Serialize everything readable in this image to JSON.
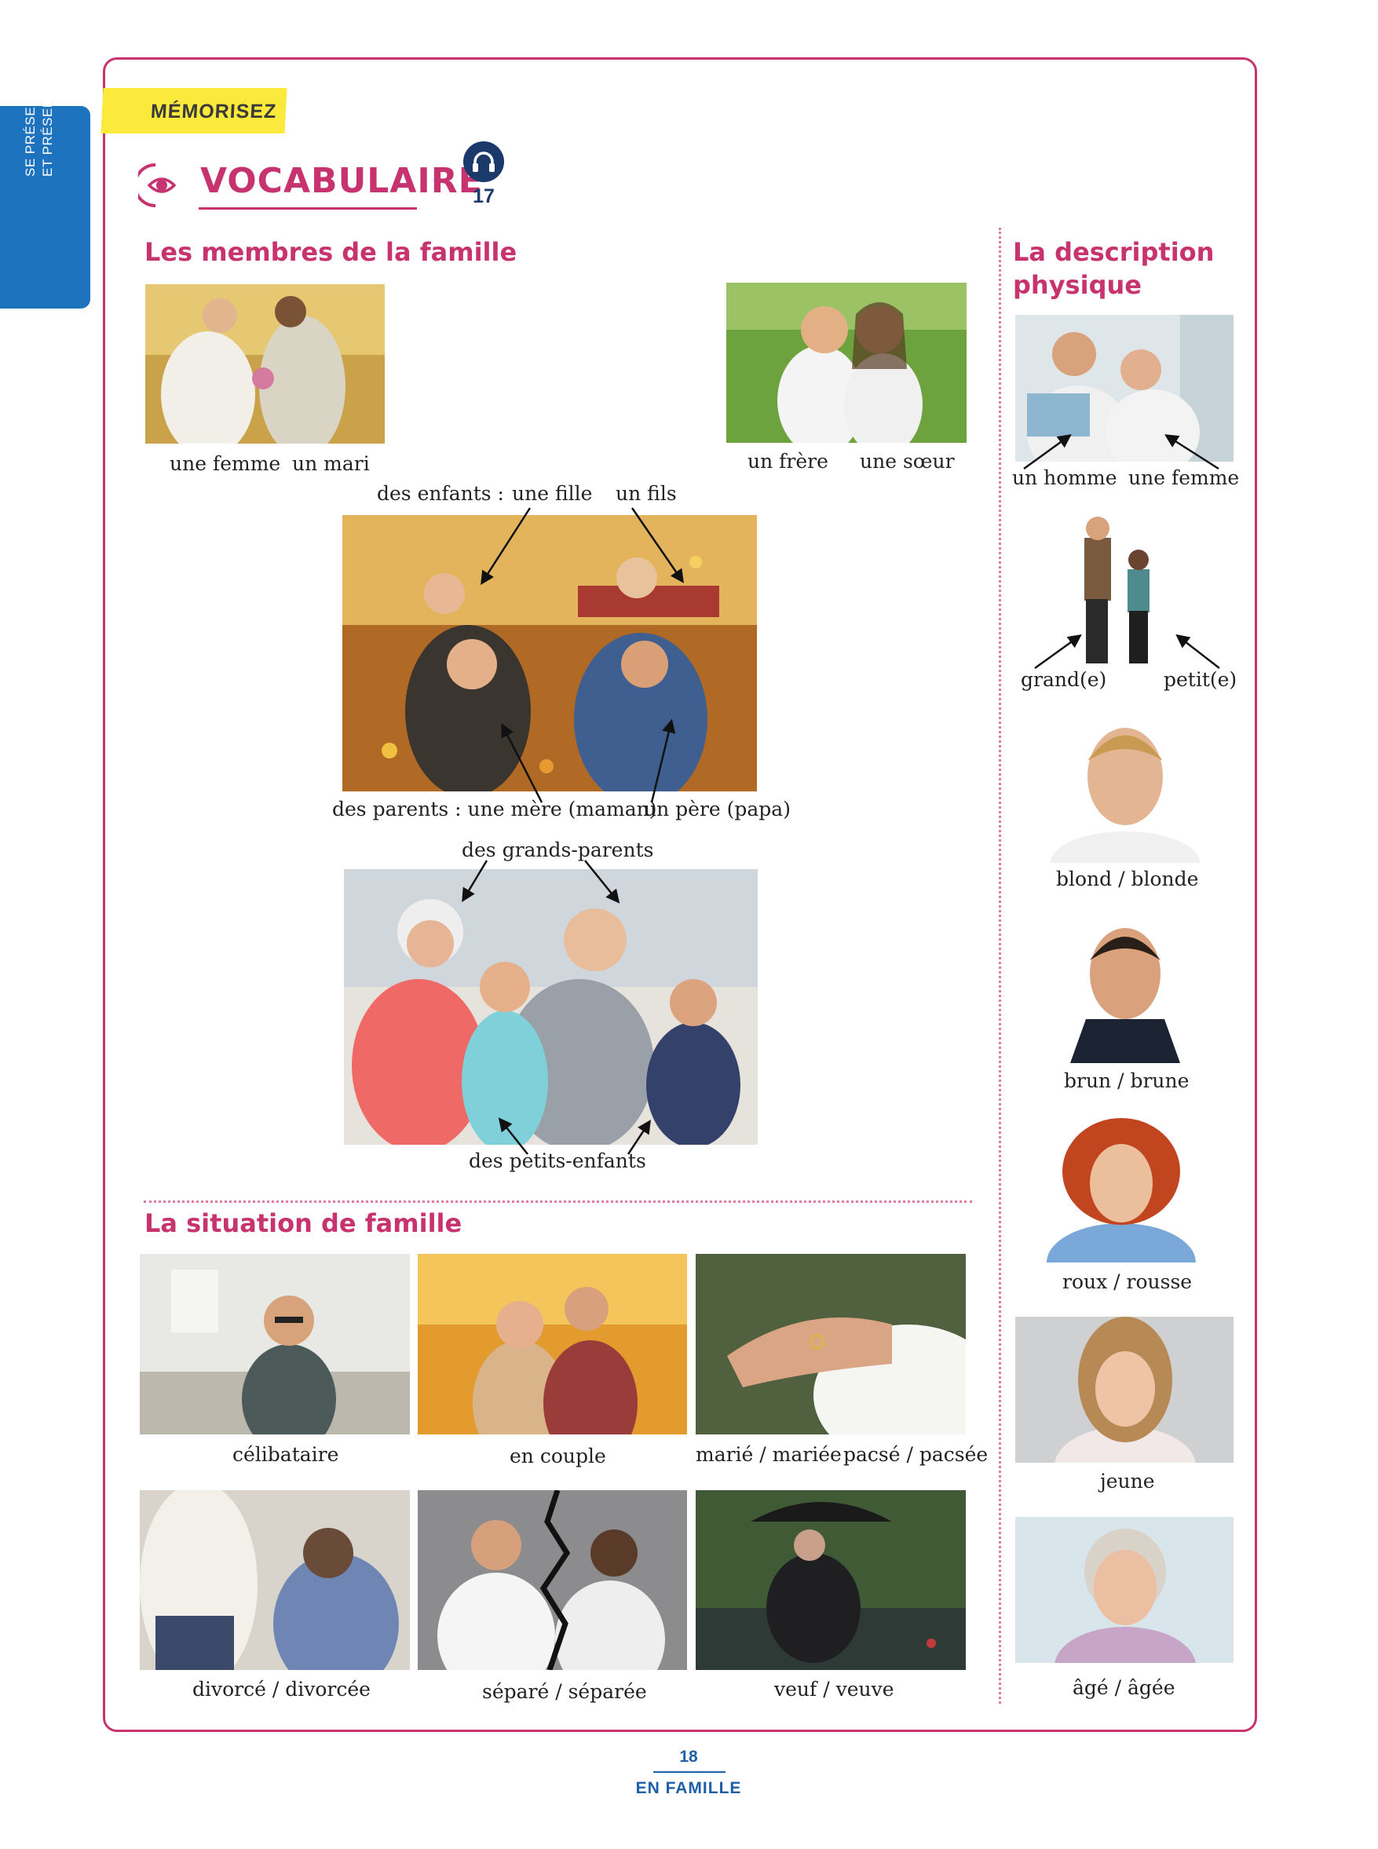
{
  "sidebar": {
    "tab_line1": "SE PRÉSENTER",
    "tab_line2": "ET PRÉSENTER"
  },
  "header": {
    "badge": "MÉMORISEZ",
    "title": "VOCABULAIRE",
    "audio_track": "17",
    "icons": [
      "eye-icon",
      "headphones-icon"
    ]
  },
  "colors": {
    "accent": "#c7336f",
    "badge": "#fbe93b",
    "tab": "#1e73be",
    "footer": "#1e5fa8"
  },
  "famille": {
    "heading": "Les membres de la famille",
    "couple_wife": "une femme",
    "couple_husband": "un mari",
    "brother": "un frère",
    "sister": "une sœur",
    "children_label": "des enfants :",
    "daughter": "une fille",
    "son": "un fils",
    "parents_line1": "des parents : une mère (maman)",
    "parents_line2": "un père (papa)",
    "grandparents": "des grands-parents",
    "grandchildren": "des petits-enfants"
  },
  "situation": {
    "heading": "La situation de famille",
    "items": [
      "célibataire",
      "en couple",
      "marié / mariée",
      "pacsé / pacsée",
      "divorcé / divorcée",
      "séparé / séparée",
      "veuf / veuve"
    ]
  },
  "description": {
    "heading_line1": "La description",
    "heading_line2": "physique",
    "man": "un homme",
    "woman": "une femme",
    "tall": "grand(e)",
    "short": "petit(e)",
    "blond": "blond / blonde",
    "brown": "brun / brune",
    "red": "roux / rousse",
    "young": "jeune",
    "old": "âgé / âgée"
  },
  "footer": {
    "page_number": "18",
    "chapter": "EN FAMILLE"
  }
}
